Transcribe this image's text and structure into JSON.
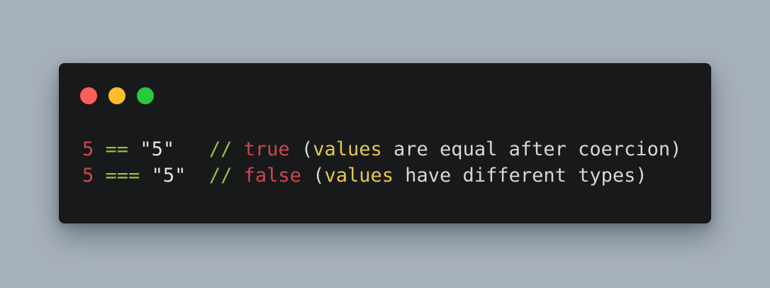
{
  "window": {
    "controls": [
      {
        "name": "close",
        "color": "#ff5f56"
      },
      {
        "name": "minimize",
        "color": "#ffbd2e"
      },
      {
        "name": "maximize",
        "color": "#27c93f"
      }
    ]
  },
  "code": {
    "lines": [
      {
        "num": "5",
        "op": "==",
        "str": "\"5\"",
        "comment_mark": "//",
        "bool": "true",
        "paren_open": "(",
        "highlight": "values",
        "rest": "are equal after coercion",
        "paren_close": ")"
      },
      {
        "num": "5",
        "op": "===",
        "str": "\"5\"",
        "comment_mark": "//",
        "bool": "false",
        "paren_open": "(",
        "highlight": "values",
        "rest": "have different types",
        "paren_close": ")"
      }
    ]
  }
}
